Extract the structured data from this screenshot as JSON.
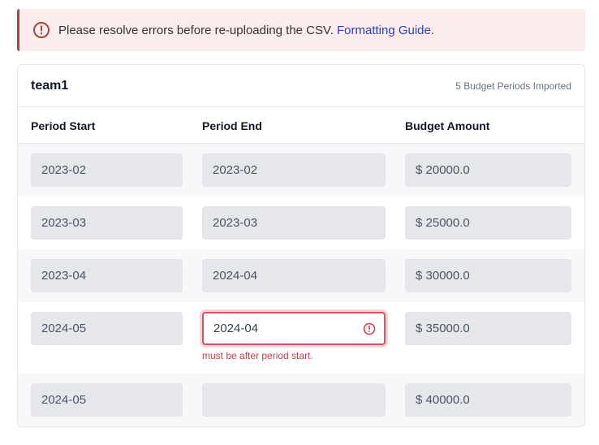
{
  "alert": {
    "message": "Please resolve errors before re-uploading the CSV.",
    "link_label": "Formatting Guide",
    "suffix": ".",
    "icon": "exclamation-circle-icon",
    "color": "#a94442"
  },
  "card": {
    "title": "team1",
    "meta": "5 Budget Periods Imported"
  },
  "table": {
    "headers": [
      "Period Start",
      "Period End",
      "Budget Amount"
    ],
    "rows": [
      {
        "start": "2023-02",
        "end": "2023-02",
        "amount": "$ 20000.0"
      },
      {
        "start": "2023-03",
        "end": "2023-03",
        "amount": "$ 25000.0"
      },
      {
        "start": "2023-04",
        "end": "2024-04",
        "amount": "$ 30000.0"
      },
      {
        "start": "2024-05",
        "end": "2024-04",
        "amount": "$ 35000.0",
        "error": "must be after period start."
      },
      {
        "start": "2024-05",
        "end": "",
        "amount": "$ 40000.0"
      }
    ]
  },
  "colors": {
    "error": "#dc5164",
    "link": "#2b3fbf"
  }
}
